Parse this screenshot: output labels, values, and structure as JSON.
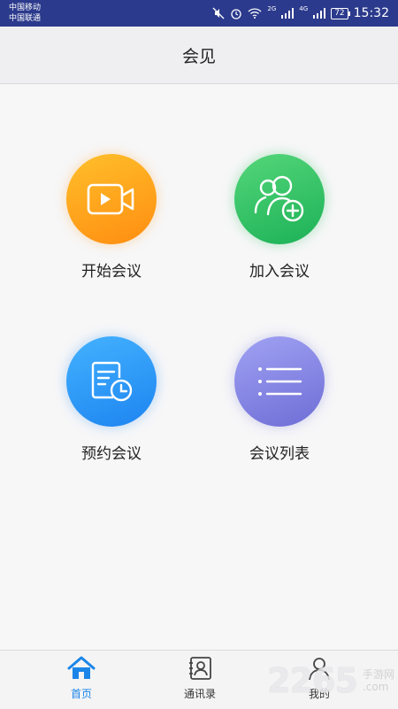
{
  "status_bar": {
    "carrier1": "中国移动",
    "carrier2": "中国联通",
    "net1": "2G",
    "net2": "4G",
    "battery": "72",
    "time": "15:32"
  },
  "header": {
    "title": "会见"
  },
  "tiles": [
    {
      "label": "开始会议",
      "icon": "video-camera-icon",
      "color": "#ff9f1a"
    },
    {
      "label": "加入会议",
      "icon": "add-user-icon",
      "color": "#28c060"
    },
    {
      "label": "预约会议",
      "icon": "schedule-icon",
      "color": "#2a92f5"
    },
    {
      "label": "会议列表",
      "icon": "list-icon",
      "color": "#8687e6"
    }
  ],
  "tabbar": {
    "items": [
      {
        "label": "首页",
        "icon": "home-icon",
        "active": true
      },
      {
        "label": "通讯录",
        "icon": "contacts-icon",
        "active": false
      },
      {
        "label": "我的",
        "icon": "profile-icon",
        "active": false
      }
    ],
    "active_color": "#1b86e8"
  },
  "watermark": {
    "number": "2265",
    "text1": "手游网",
    "text2": ".com"
  }
}
